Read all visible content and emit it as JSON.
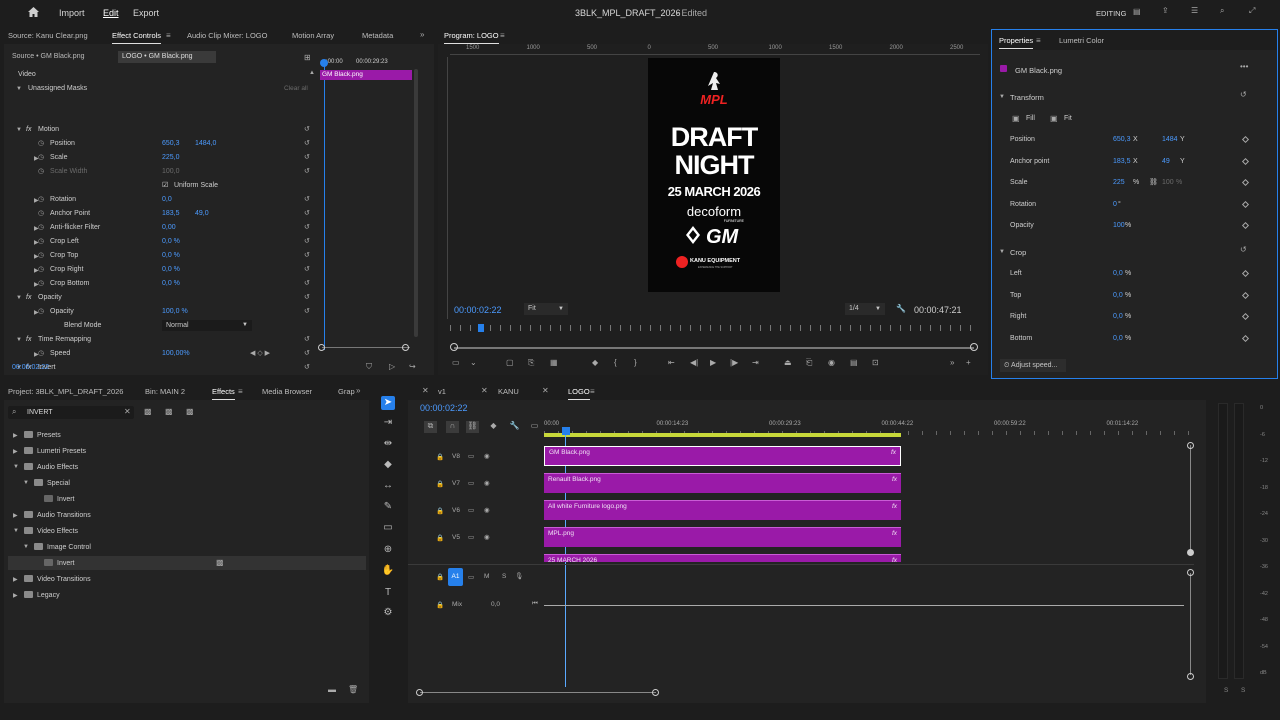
{
  "top": {
    "import": "Import",
    "edit": "Edit",
    "export": "Export",
    "title": "3BLK_MPL_DRAFT_2026",
    "edited": "- Edited",
    "workspace": "EDITING"
  },
  "source_panel": {
    "tabs": [
      "Source: Kanu Clear.png",
      "Effect Controls",
      "Audio Clip Mixer: LOGO",
      "Motion Array",
      "Metadata"
    ],
    "clip_source": "Source • GM Black.png",
    "clip_active": "LOGO • GM Black.png",
    "ruler_start": ":00:00",
    "ruler_end": "00:00:29:23",
    "clip_label": "GM Black.png",
    "video": "Video",
    "unassigned_masks": "Unassigned Masks",
    "clear_all": "Clear all",
    "rows": [
      {
        "label": "Motion",
        "value": "",
        "value2": ""
      },
      {
        "label": "Position",
        "value": "650,3",
        "value2": "1484,0"
      },
      {
        "label": "Scale",
        "value": "225,0",
        "value2": ""
      },
      {
        "label": "Scale Width",
        "value": "100,0",
        "value2": ""
      },
      {
        "label": "Uniform Scale",
        "value": "",
        "value2": ""
      },
      {
        "label": "Rotation",
        "value": "0,0",
        "value2": ""
      },
      {
        "label": "Anchor Point",
        "value": "183,5",
        "value2": "49,0"
      },
      {
        "label": "Anti-flicker Filter",
        "value": "0,00",
        "value2": ""
      },
      {
        "label": "Crop Left",
        "value": "0,0 %",
        "value2": ""
      },
      {
        "label": "Crop Top",
        "value": "0,0 %",
        "value2": ""
      },
      {
        "label": "Crop Right",
        "value": "0,0 %",
        "value2": ""
      },
      {
        "label": "Crop Bottom",
        "value": "0,0 %",
        "value2": ""
      },
      {
        "label": "Opacity",
        "value": "",
        "value2": ""
      },
      {
        "label": "Opacity",
        "value": "100,0 %",
        "value2": ""
      },
      {
        "label": "Blend Mode",
        "value": "Normal",
        "value2": ""
      },
      {
        "label": "Time Remapping",
        "value": "",
        "value2": ""
      },
      {
        "label": "Speed",
        "value": "100,00%",
        "value2": ""
      },
      {
        "label": "Invert",
        "value": "",
        "value2": ""
      }
    ],
    "timecode": "00:00:02:22"
  },
  "program": {
    "title": "Program: LOGO",
    "ruler": [
      "1500",
      "1000",
      "500",
      "0",
      "500",
      "1000",
      "1500",
      "2000",
      "2500"
    ],
    "timecode": "00:00:02:22",
    "fit": "Fit",
    "quality": "1/4",
    "duration": "00:00:47:21",
    "poster": {
      "logo": "MPL",
      "line1": "DRAFT",
      "line2": "NIGHT",
      "date": "25 MARCH 2026",
      "brand1": "decoform",
      "brand1_sub": "FURNITURE",
      "brand2": "GM",
      "brand3": "KANU EQUIPMENT",
      "brand3_sub": "EXPERIENCE THE SUPPORT"
    }
  },
  "properties": {
    "tabs": [
      "Properties",
      "Lumetri Color"
    ],
    "clip": "GM Black.png",
    "transform": "Transform",
    "fill": "Fill",
    "fit": "Fit",
    "rows": [
      {
        "label": "Position",
        "v1": "650,3",
        "u1": "X",
        "v2": "1484",
        "u2": "Y"
      },
      {
        "label": "Anchor point",
        "v1": "183,5",
        "u1": "X",
        "v2": "49",
        "u2": "Y"
      },
      {
        "label": "Scale",
        "v1": "225",
        "u1": "%",
        "v2": "100",
        "u2": "%"
      },
      {
        "label": "Rotation",
        "v1": "0",
        "u1": "°",
        "v2": "",
        "u2": ""
      },
      {
        "label": "Opacity",
        "v1": "100",
        "u1": "%",
        "v2": "",
        "u2": ""
      }
    ],
    "crop": "Crop",
    "crop_rows": [
      {
        "label": "Left",
        "v": "0,0",
        "u": "%"
      },
      {
        "label": "Top",
        "v": "0,0",
        "u": "%"
      },
      {
        "label": "Right",
        "v": "0,0",
        "u": "%"
      },
      {
        "label": "Bottom",
        "v": "0,0",
        "u": "%"
      }
    ],
    "adjust_speed": "Adjust speed..."
  },
  "project": {
    "tabs": [
      "Project: 3BLK_MPL_DRAFT_2026",
      "Bin: MAIN 2",
      "Effects",
      "Media Browser",
      "Grap"
    ],
    "search": "INVERT",
    "tree": [
      "Presets",
      "Lumetri Presets",
      "Audio Effects",
      "Special",
      "Invert",
      "Audio Transitions",
      "Video Effects",
      "Image Control",
      "Invert",
      "Video Transitions",
      "Legacy"
    ]
  },
  "timeline": {
    "tabs": [
      "v1",
      "KANU",
      "LOGO"
    ],
    "timecode": "00:00:02:22",
    "ruler": [
      "00:00",
      "00:00:14:23",
      "00:00:29:23",
      "00:00:44:22",
      "00:00:59:22",
      "00:01:14:22"
    ],
    "tracks": [
      {
        "name": "V8",
        "clip": "GM Black.png"
      },
      {
        "name": "V7",
        "clip": "Renault Black.png"
      },
      {
        "name": "V6",
        "clip": "All white Furniture logo.png"
      },
      {
        "name": "V5",
        "clip": "MPL.png"
      },
      {
        "name": "",
        "clip": "25 MARCH 2026"
      }
    ],
    "audio": {
      "name": "A1",
      "m": "M",
      "s": "S"
    },
    "mix": "Mix",
    "mix_value": "0,0"
  },
  "meter": {
    "labels": [
      "0",
      "-6",
      "-12",
      "-18",
      "-24",
      "-30",
      "-36",
      "-42",
      "-48",
      "-54",
      "dB"
    ],
    "ch": [
      "S",
      "S"
    ]
  },
  "colors": {
    "accent": "#2680eb",
    "clip": "#9a1aa8",
    "blue_value": "#4c9bff"
  }
}
